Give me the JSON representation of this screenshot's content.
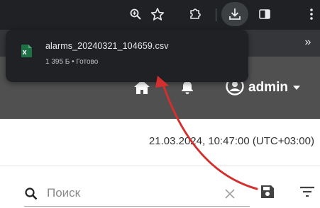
{
  "download_popup": {
    "file_name": "alarms_20240321_104659.csv",
    "file_meta": "1 395 Б • Готово",
    "file_icon": "excel-csv-file-icon"
  },
  "browser_toolbar": {
    "icons": [
      "zoom-icon",
      "star-icon",
      "extensions-icon",
      "download-icon",
      "side-panel-icon",
      "kebab-menu-icon"
    ],
    "active_icon": "download-icon"
  },
  "bookmark_bar": {
    "overflow_label": "»"
  },
  "header": {
    "home_icon": "home-icon",
    "notifications_icon": "bell-icon",
    "user_icon": "account-circle-icon",
    "user_name": "admin",
    "colors": {
      "background": "#505050",
      "foreground": "#ffffff"
    }
  },
  "status": {
    "timestamp": "21.03.2024, 10:47:00 (UTC+03:00)"
  },
  "search": {
    "placeholder": "Поиск",
    "value": "",
    "search_icon": "search-icon",
    "clear_icon": "close-icon"
  },
  "toolbar_actions": {
    "save_icon": "save-icon",
    "filter_icon": "filter-icon"
  },
  "annotation": {
    "color": "#d32f2f",
    "shape": "curved-arrow"
  }
}
